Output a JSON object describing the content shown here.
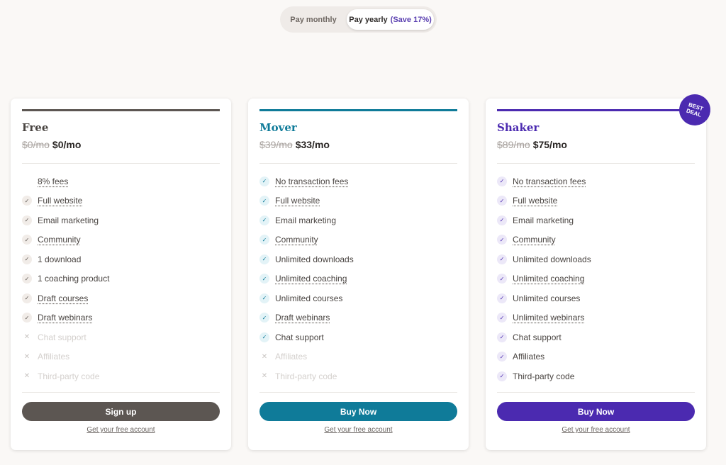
{
  "billing_toggle": {
    "monthly_label": "Pay monthly",
    "yearly_label": "Pay yearly",
    "yearly_save": "(Save 17%)",
    "selected": "yearly"
  },
  "plans": [
    {
      "name": "Free",
      "accent": "#5c5652",
      "check_bg": "#f1ece8",
      "check_color": "#5c5652",
      "old_price": "$0/mo",
      "new_price": "$0/mo",
      "features": [
        {
          "label": "8% fees",
          "included": true,
          "dotted": true,
          "icon": false
        },
        {
          "label": "Full website",
          "included": true,
          "dotted": true
        },
        {
          "label": "Email marketing",
          "included": true,
          "dotted": false
        },
        {
          "label": "Community",
          "included": true,
          "dotted": true
        },
        {
          "label": "1 download",
          "included": true,
          "dotted": false
        },
        {
          "label": "1 coaching product",
          "included": true,
          "dotted": false
        },
        {
          "label": "Draft courses",
          "included": true,
          "dotted": true
        },
        {
          "label": "Draft webinars",
          "included": true,
          "dotted": true
        },
        {
          "label": "Chat support",
          "included": false,
          "dotted": false
        },
        {
          "label": "Affiliates",
          "included": false,
          "dotted": false
        },
        {
          "label": "Third-party code",
          "included": false,
          "dotted": false
        }
      ],
      "cta_label": "Sign up",
      "cta_color": "#5c5652",
      "sub_link": "Get your free account"
    },
    {
      "name": "Mover",
      "accent": "#0f7b99",
      "check_bg": "#e3f3f7",
      "check_color": "#0f7b99",
      "old_price": "$39/mo",
      "new_price": "$33/mo",
      "features": [
        {
          "label": "No transaction fees",
          "included": true,
          "dotted": true
        },
        {
          "label": "Full website",
          "included": true,
          "dotted": true
        },
        {
          "label": "Email marketing",
          "included": true,
          "dotted": false
        },
        {
          "label": "Community",
          "included": true,
          "dotted": true
        },
        {
          "label": "Unlimited downloads",
          "included": true,
          "dotted": false
        },
        {
          "label": "Unlimited coaching",
          "included": true,
          "dotted": true
        },
        {
          "label": "Unlimited courses",
          "included": true,
          "dotted": false
        },
        {
          "label": "Draft webinars",
          "included": true,
          "dotted": true
        },
        {
          "label": "Chat support",
          "included": true,
          "dotted": false
        },
        {
          "label": "Affiliates",
          "included": false,
          "dotted": false
        },
        {
          "label": "Third-party code",
          "included": false,
          "dotted": false
        }
      ],
      "cta_label": "Buy Now",
      "cta_color": "#0f7b99",
      "sub_link": "Get your free account"
    },
    {
      "name": "Shaker",
      "accent": "#4b2ab0",
      "check_bg": "#ece8f8",
      "check_color": "#4b2ab0",
      "old_price": "$89/mo",
      "new_price": "$75/mo",
      "features": [
        {
          "label": "No transaction fees",
          "included": true,
          "dotted": true
        },
        {
          "label": "Full website",
          "included": true,
          "dotted": true
        },
        {
          "label": "Email marketing",
          "included": true,
          "dotted": false
        },
        {
          "label": "Community",
          "included": true,
          "dotted": true
        },
        {
          "label": "Unlimited downloads",
          "included": true,
          "dotted": false
        },
        {
          "label": "Unlimited coaching",
          "included": true,
          "dotted": true
        },
        {
          "label": "Unlimited courses",
          "included": true,
          "dotted": false
        },
        {
          "label": "Unlimited webinars",
          "included": true,
          "dotted": true
        },
        {
          "label": "Chat support",
          "included": true,
          "dotted": false
        },
        {
          "label": "Affiliates",
          "included": true,
          "dotted": false
        },
        {
          "label": "Third-party code",
          "included": true,
          "dotted": false
        }
      ],
      "cta_label": "Buy Now",
      "cta_color": "#4b2ab0",
      "sub_link": "Get your free account"
    }
  ],
  "badge": {
    "line1": "BEST",
    "line2": "DEAL",
    "color": "#4b2ab0"
  },
  "icons": {
    "check": "✓",
    "cross": "✕"
  }
}
